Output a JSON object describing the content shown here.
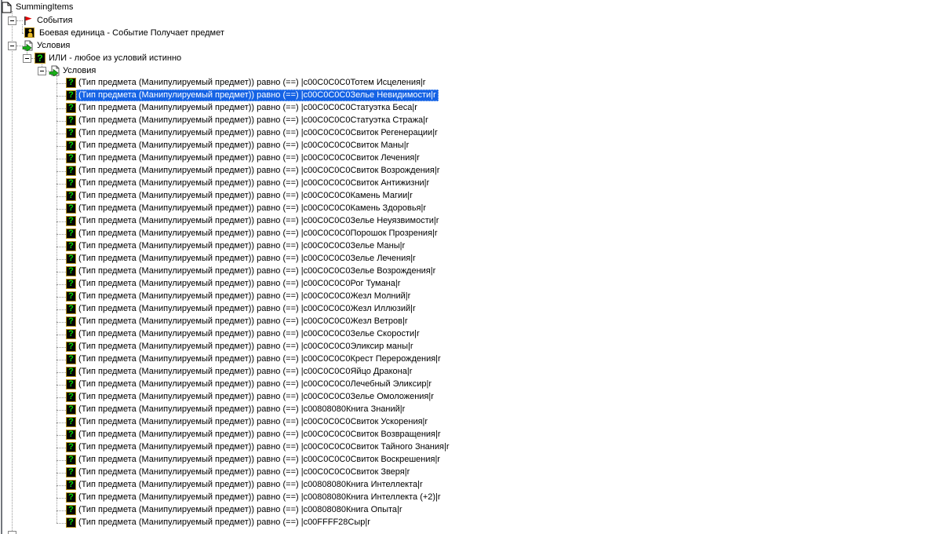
{
  "window": {
    "app": "World Editor Trigger Editor"
  },
  "colors": {
    "selection_bg": "#1563E5",
    "selection_text": "#FFFFFF",
    "condition_icon_green": "#00DD00",
    "condition_icon_border_gold": "#B5921C",
    "flag_red": "#E00000",
    "arrow_green": "#18B318",
    "tree_line_gray": "#9A9A9A"
  },
  "tree": {
    "root": {
      "label": "SummingItems",
      "icon": "document-icon"
    },
    "events_category": {
      "label": "События",
      "icon": "flag-icon",
      "expanded": true
    },
    "event": {
      "label": "Боевая единица - Событие Получает предмет",
      "icon": "unit-event-icon"
    },
    "conditions_category": {
      "label": "Условия",
      "icon": "conditions-page-icon",
      "expanded": true
    },
    "or_condition": {
      "label": "ИЛИ - любое из условий истинно",
      "icon": "question-icon",
      "expanded": true
    },
    "inner_conditions_category": {
      "label": "Условия",
      "icon": "conditions-page-icon",
      "expanded": true
    },
    "condition_prefix": "(Тип предмета (Манипулируемый предмет)) равно (==) ",
    "condition_suffix": "|r",
    "conditions": [
      {
        "color_code": "|c00C0C0C0",
        "item": "Тотем Исцеления",
        "selected": false
      },
      {
        "color_code": "|c00C0C0C0",
        "item": "Зелье Невидимости",
        "selected": true
      },
      {
        "color_code": "|c00C0C0C0",
        "item": "Статуэтка Беса",
        "selected": false
      },
      {
        "color_code": "|c00C0C0C0",
        "item": "Статуэтка Стража",
        "selected": false
      },
      {
        "color_code": "|c00C0C0C0",
        "item": "Свиток Регенерации",
        "selected": false
      },
      {
        "color_code": "|c00C0C0C0",
        "item": "Свиток Маны",
        "selected": false
      },
      {
        "color_code": "|c00C0C0C0",
        "item": "Свиток Лечения",
        "selected": false
      },
      {
        "color_code": "|c00C0C0C0",
        "item": "Свиток Возрождения",
        "selected": false
      },
      {
        "color_code": "|c00C0C0C0",
        "item": "Свиток Антижизни",
        "selected": false
      },
      {
        "color_code": "|c00C0C0C0",
        "item": "Камень Магии",
        "selected": false
      },
      {
        "color_code": "|c00C0C0C0",
        "item": "Камень Здоровья",
        "selected": false
      },
      {
        "color_code": "|c00C0C0C0",
        "item": "Зелье Неуязвимости",
        "selected": false
      },
      {
        "color_code": "|c00C0C0C0",
        "item": "Порошок Прозрения",
        "selected": false
      },
      {
        "color_code": "|c00C0C0C0",
        "item": "Зелье Маны",
        "selected": false
      },
      {
        "color_code": "|c00C0C0C0",
        "item": "Зелье Лечения",
        "selected": false
      },
      {
        "color_code": "|c00C0C0C0",
        "item": "Зелье Возрождения",
        "selected": false
      },
      {
        "color_code": "|c00C0C0C0",
        "item": "Рог Тумана",
        "selected": false
      },
      {
        "color_code": "|c00C0C0C0",
        "item": "Жезл Молний",
        "selected": false
      },
      {
        "color_code": "|c00C0C0C0",
        "item": "Жезл Иллюзий",
        "selected": false
      },
      {
        "color_code": "|c00C0C0C0",
        "item": "Жезл Ветров",
        "selected": false
      },
      {
        "color_code": "|c00C0C0C0",
        "item": "Зелье Скорости",
        "selected": false
      },
      {
        "color_code": "|c00C0C0C0",
        "item": "Эликсир маны",
        "selected": false
      },
      {
        "color_code": "|c00C0C0C0",
        "item": "Крест Перерождения",
        "selected": false
      },
      {
        "color_code": "|c00C0C0C0",
        "item": "Яйцо Дракона",
        "selected": false
      },
      {
        "color_code": "|c00C0C0C0",
        "item": "Лечебный Эликсир",
        "selected": false
      },
      {
        "color_code": "|c00C0C0C0",
        "item": "Зелье Омоложения",
        "selected": false
      },
      {
        "color_code": "|c00808080",
        "item": "Книга Знаний",
        "selected": false
      },
      {
        "color_code": "|c00C0C0C0",
        "item": "Свиток Ускорения",
        "selected": false
      },
      {
        "color_code": "|c00C0C0C0",
        "item": "Свиток Возвращения",
        "selected": false
      },
      {
        "color_code": "|c00C0C0C0",
        "item": "Свиток Тайного Знания",
        "selected": false
      },
      {
        "color_code": "|c00C0C0C0",
        "item": "Свиток Воскрешения",
        "selected": false
      },
      {
        "color_code": "|c00C0C0C0",
        "item": "Свиток Зверя",
        "selected": false
      },
      {
        "color_code": "|c00808080",
        "item": "Книга Интеллекта",
        "selected": false
      },
      {
        "color_code": "|c00808080",
        "item": "Книга Интеллекта (+2)",
        "selected": false
      },
      {
        "color_code": "|c00808080",
        "item": "Книга Опыта",
        "selected": false
      },
      {
        "color_code": "|c00FFFF28",
        "item": "Сыр",
        "selected": false
      }
    ],
    "next_sibling_partial": true
  }
}
